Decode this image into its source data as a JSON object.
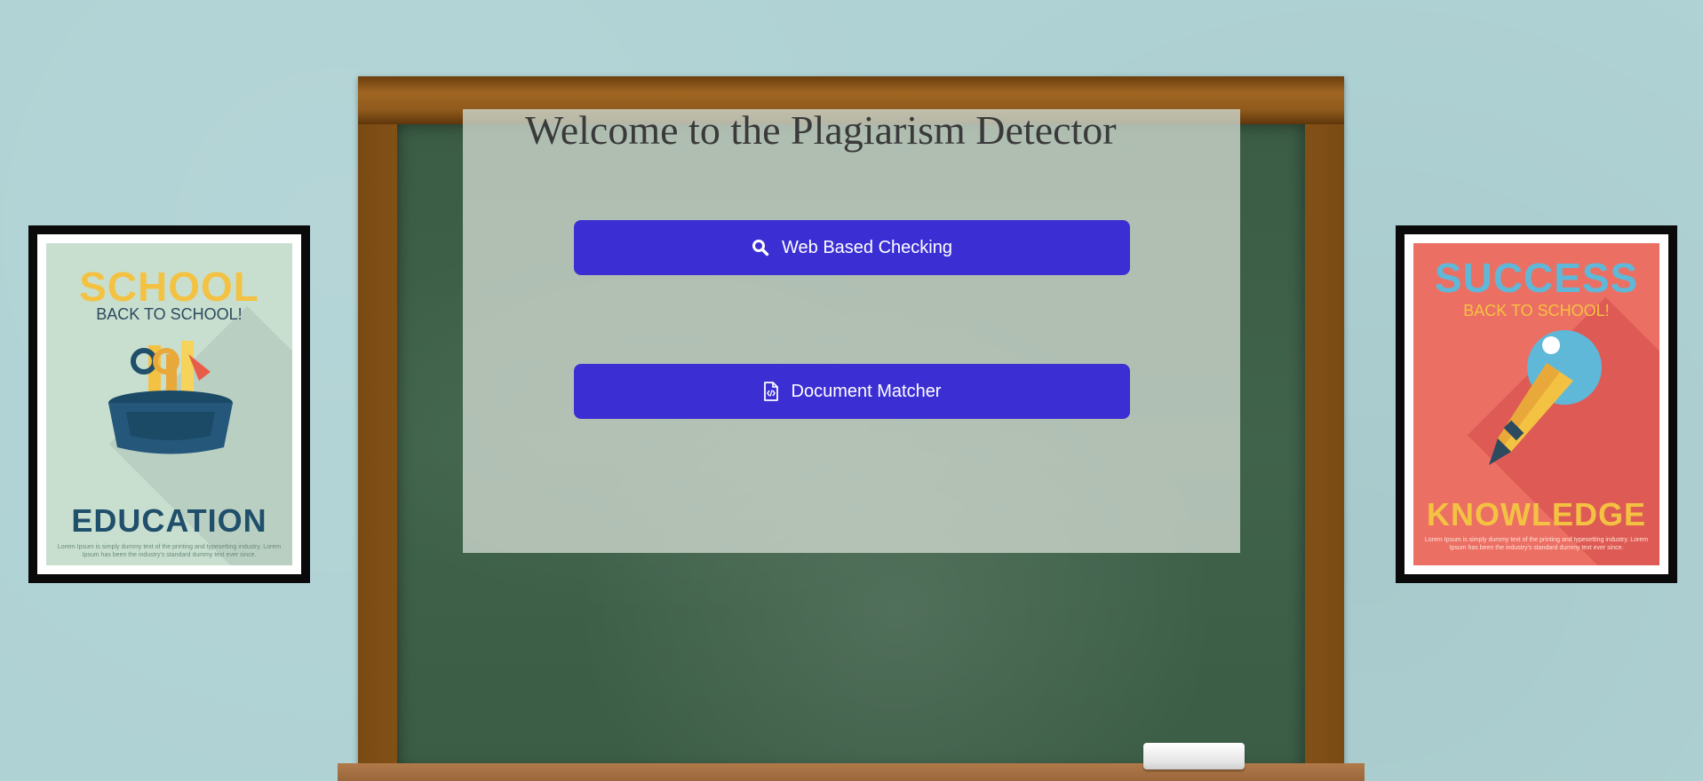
{
  "page": {
    "title": "Welcome to the Plagiarism Detector"
  },
  "actions": {
    "web_based_checking": {
      "label": "Web Based Checking",
      "icon": "search-icon"
    },
    "document_matcher": {
      "label": "Document Matcher",
      "icon": "file-code-icon"
    }
  },
  "posters": {
    "left": {
      "headline": "SCHOOL",
      "subtitle": "BACK TO SCHOOL!",
      "footer": "EDUCATION",
      "fine_print": "Lorem Ipsum is simply dummy text of the printing and typesetting industry. Lorem Ipsum has been the industry's standard dummy text ever since."
    },
    "right": {
      "headline": "SUCCESS",
      "subtitle": "BACK TO SCHOOL!",
      "footer": "KNOWLEDGE",
      "fine_print": "Lorem Ipsum is simply dummy text of the printing and typesetting industry. Lorem Ipsum has been the industry's standard dummy text ever since."
    }
  },
  "colors": {
    "button": "#3b2fd4",
    "wall": "#afd2d4",
    "chalkboard": "#3d5f47"
  }
}
